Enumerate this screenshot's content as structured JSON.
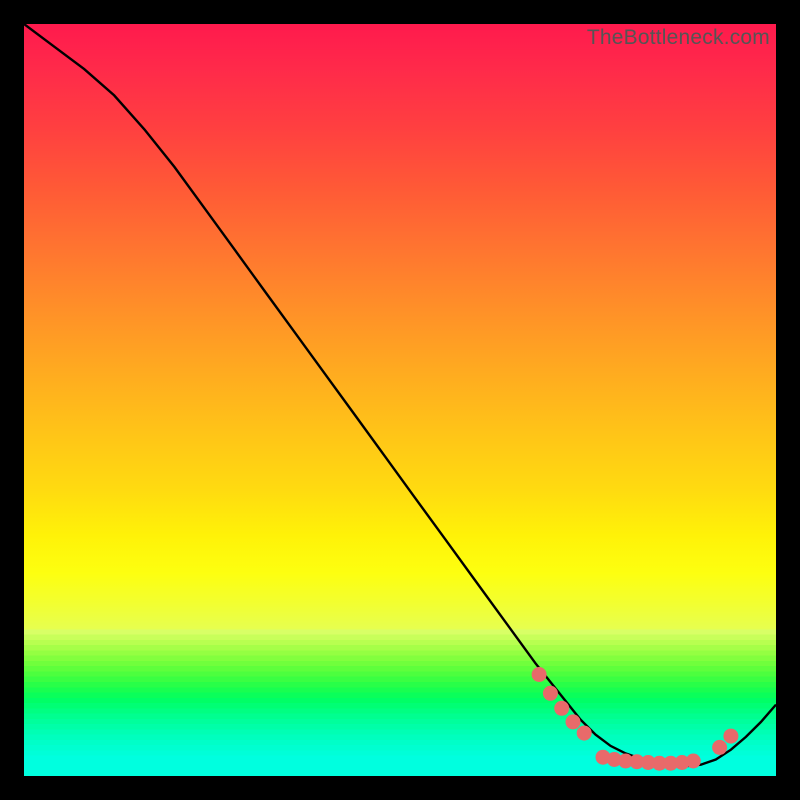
{
  "watermark": "TheBottleneck.com",
  "chart_data": {
    "type": "line",
    "title": "",
    "xlabel": "",
    "ylabel": "",
    "xlim": [
      0,
      100
    ],
    "ylim": [
      0,
      100
    ],
    "series": [
      {
        "name": "curve",
        "x": [
          0,
          4,
          8,
          12,
          16,
          20,
          24,
          28,
          32,
          36,
          40,
          44,
          48,
          52,
          56,
          60,
          64,
          68,
          72,
          74,
          76,
          78,
          80,
          82,
          84,
          86,
          88,
          90,
          92,
          94,
          96,
          98,
          100
        ],
        "y": [
          100,
          97,
          94,
          90.5,
          86,
          81,
          75.5,
          70,
          64.5,
          59,
          53.5,
          48,
          42.5,
          37,
          31.5,
          26,
          20.5,
          15,
          10,
          7.5,
          5.5,
          4,
          3,
          2.3,
          1.8,
          1.5,
          1.3,
          1.5,
          2.2,
          3.5,
          5.2,
          7.2,
          9.5
        ]
      }
    ],
    "markers": [
      {
        "x": 68.5,
        "y": 13.5
      },
      {
        "x": 70.0,
        "y": 11.0
      },
      {
        "x": 71.5,
        "y": 9.0
      },
      {
        "x": 73.0,
        "y": 7.2
      },
      {
        "x": 74.5,
        "y": 5.7
      },
      {
        "x": 77.0,
        "y": 2.5
      },
      {
        "x": 78.5,
        "y": 2.2
      },
      {
        "x": 80.0,
        "y": 2.0
      },
      {
        "x": 81.5,
        "y": 1.9
      },
      {
        "x": 83.0,
        "y": 1.8
      },
      {
        "x": 84.5,
        "y": 1.7
      },
      {
        "x": 86.0,
        "y": 1.7
      },
      {
        "x": 87.5,
        "y": 1.8
      },
      {
        "x": 89.0,
        "y": 2.0
      },
      {
        "x": 92.5,
        "y": 3.8
      },
      {
        "x": 94.0,
        "y": 5.3
      }
    ],
    "marker_color": "#e86a6a",
    "line_color": "#000000",
    "gradient_stops": [
      {
        "pos": 0.0,
        "color": "#ff1a4d"
      },
      {
        "pos": 0.35,
        "color": "#ff8a28"
      },
      {
        "pos": 0.65,
        "color": "#ffe010"
      },
      {
        "pos": 0.8,
        "color": "#e6ff50"
      },
      {
        "pos": 1.0,
        "color": "#00ffdf"
      }
    ]
  }
}
